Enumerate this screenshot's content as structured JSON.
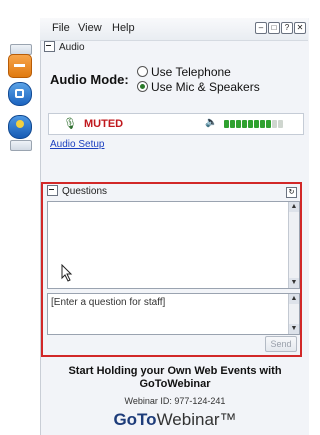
{
  "menu": {
    "file": "File",
    "view": "View",
    "help": "Help"
  },
  "window_buttons": [
    "minimize",
    "restore",
    "help",
    "close"
  ],
  "audio": {
    "section_title": "Audio",
    "mode_label": "Audio Mode:",
    "options": [
      {
        "label": "Use Telephone",
        "selected": false
      },
      {
        "label": "Use Mic & Speakers",
        "selected": true
      }
    ],
    "status": "MUTED",
    "level_filled": 8,
    "level_total": 10,
    "setup_link": "Audio Setup"
  },
  "questions": {
    "section_title": "Questions",
    "input_placeholder": "[Enter a question for staff]",
    "send_label": "Send"
  },
  "promo": {
    "line1": "Start Holding your Own Web Events with",
    "line2": "GoToWebinar",
    "webinar_id": "Webinar ID: 977-124-241",
    "logo_bold": "GoTo",
    "logo_rest": "Webinar™"
  },
  "colors": {
    "muted": "#c0181d",
    "level": "#2fa12f",
    "highlight": "#d22828",
    "link": "#1b3fbf"
  }
}
